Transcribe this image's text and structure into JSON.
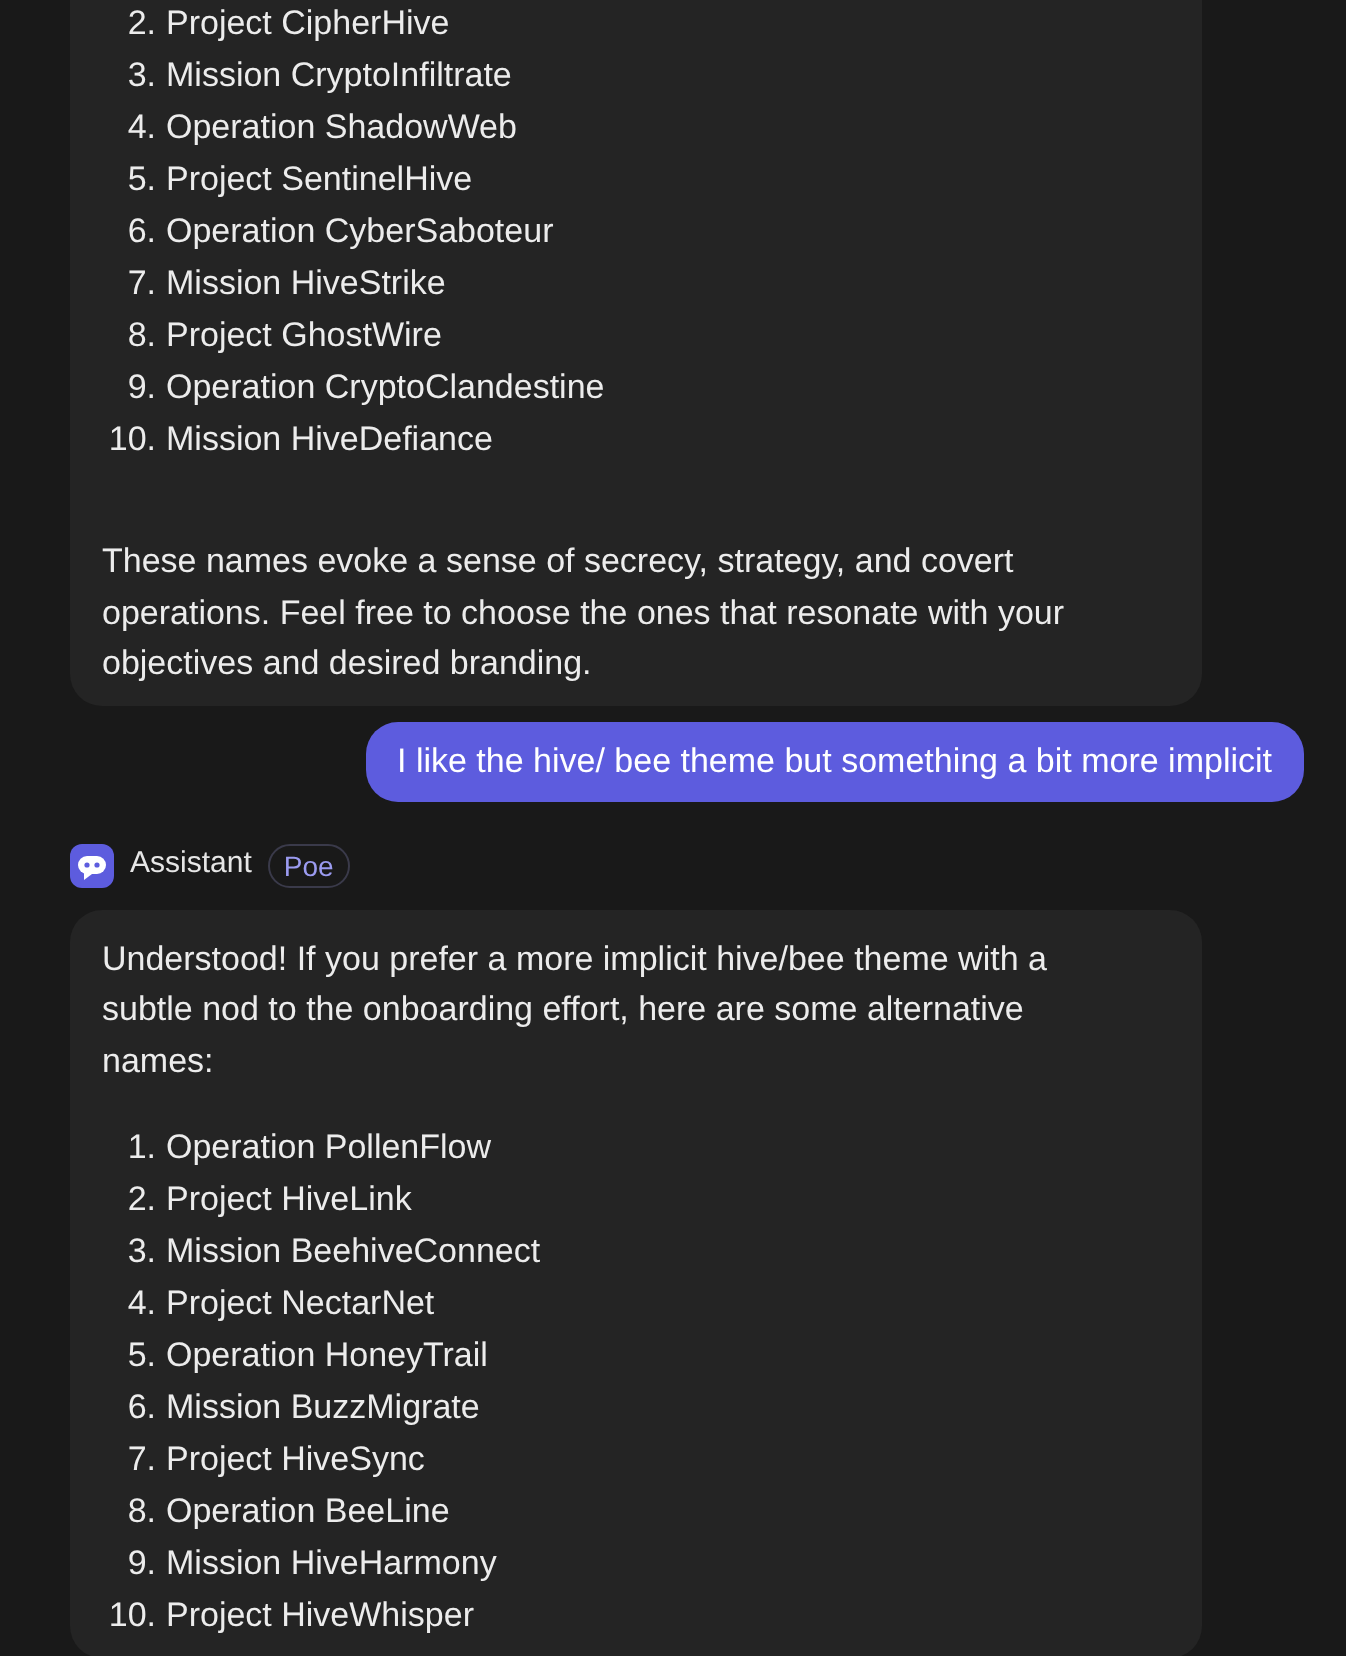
{
  "messages": [
    {
      "kind": "bot",
      "list": [
        {
          "number": "2.",
          "text": "Project CipherHive"
        },
        {
          "number": "3.",
          "text": "Mission CryptoInfiltrate"
        },
        {
          "number": "4.",
          "text": "Operation ShadowWeb"
        },
        {
          "number": "5.",
          "text": "Project SentinelHive"
        },
        {
          "number": "6.",
          "text": "Operation CyberSaboteur"
        },
        {
          "number": "7.",
          "text": "Mission HiveStrike"
        },
        {
          "number": "8.",
          "text": "Project GhostWire"
        },
        {
          "number": "9.",
          "text": "Operation CryptoClandestine"
        },
        {
          "number": "10.",
          "text": "Mission HiveDefiance"
        }
      ],
      "paragraphs_after": [
        "These names evoke a sense of secrecy, strategy, and covert operations. Feel free to choose the ones that resonate with your objectives and desired branding."
      ]
    },
    {
      "kind": "user",
      "text": "I like the hive/ bee theme but something a bit more implicit"
    },
    {
      "kind": "bot",
      "sender": "Assistant",
      "badge": "Poe",
      "paragraphs_before": [
        "Understood! If you prefer a more implicit hive/bee theme with a subtle nod to the onboarding effort, here are some alternative names:"
      ],
      "list": [
        {
          "number": "1.",
          "text": "Operation PollenFlow"
        },
        {
          "number": "2.",
          "text": "Project HiveLink"
        },
        {
          "number": "3.",
          "text": "Mission BeehiveConnect"
        },
        {
          "number": "4.",
          "text": "Project NectarNet"
        },
        {
          "number": "5.",
          "text": "Operation HoneyTrail"
        },
        {
          "number": "6.",
          "text": "Mission BuzzMigrate"
        },
        {
          "number": "7.",
          "text": "Project HiveSync"
        },
        {
          "number": "8.",
          "text": "Operation BeeLine"
        },
        {
          "number": "9.",
          "text": "Mission HiveHarmony"
        },
        {
          "number": "10.",
          "text": "Project HiveWhisper"
        }
      ]
    }
  ]
}
